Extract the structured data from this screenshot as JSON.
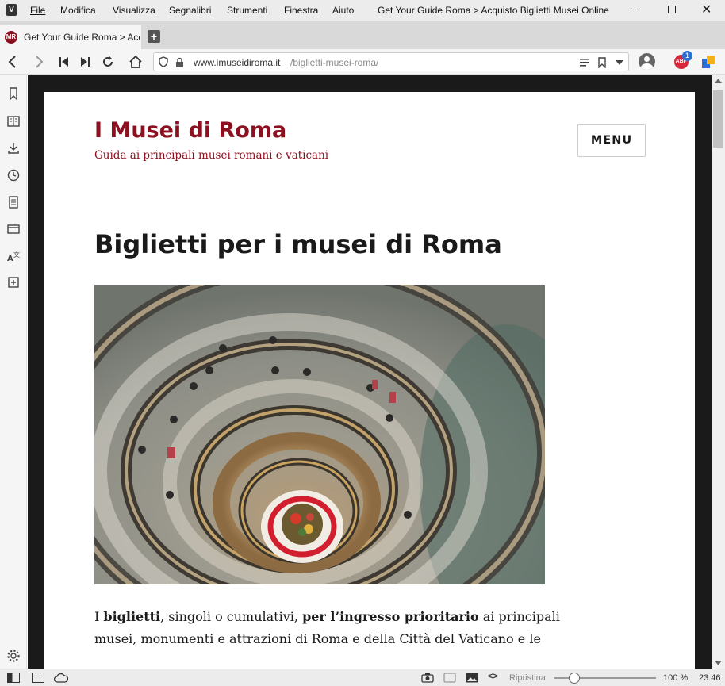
{
  "window": {
    "menus": [
      "File",
      "Modifica",
      "Visualizza",
      "Segnalibri",
      "Strumenti",
      "Finestra",
      "Aiuto"
    ],
    "title": "Get Your Guide Roma > Acquisto Biglietti Musei Online"
  },
  "tab": {
    "label": "Get Your Guide Roma > Acc"
  },
  "address": {
    "domain": "www.imuseidiroma.it",
    "path": "/biglietti-musei-roma/"
  },
  "extensions": {
    "abp_badge": "1",
    "abp_label": "ABP"
  },
  "site": {
    "title": "I Musei di Roma",
    "tagline": "Guida ai principali musei romani e vaticani",
    "menu_label": "MENU"
  },
  "article": {
    "heading": "Biglietti per i musei di Roma",
    "p1": "I ",
    "p1_bold1": "biglietti",
    "p1_2": ", singoli o cumulativi, ",
    "p1_bold2": "per l’ingresso prioritario",
    "p1_3": " ai principali",
    "p2": "musei, monumenti e attrazioni di Roma e della Città del Vaticano e le"
  },
  "statusbar": {
    "reset_label": "Ripristina",
    "zoom": "100 %",
    "zoom_level": 0.5,
    "clock": "23:46"
  },
  "colors": {
    "brand": "#8b1020",
    "chrome": "#ececec"
  }
}
